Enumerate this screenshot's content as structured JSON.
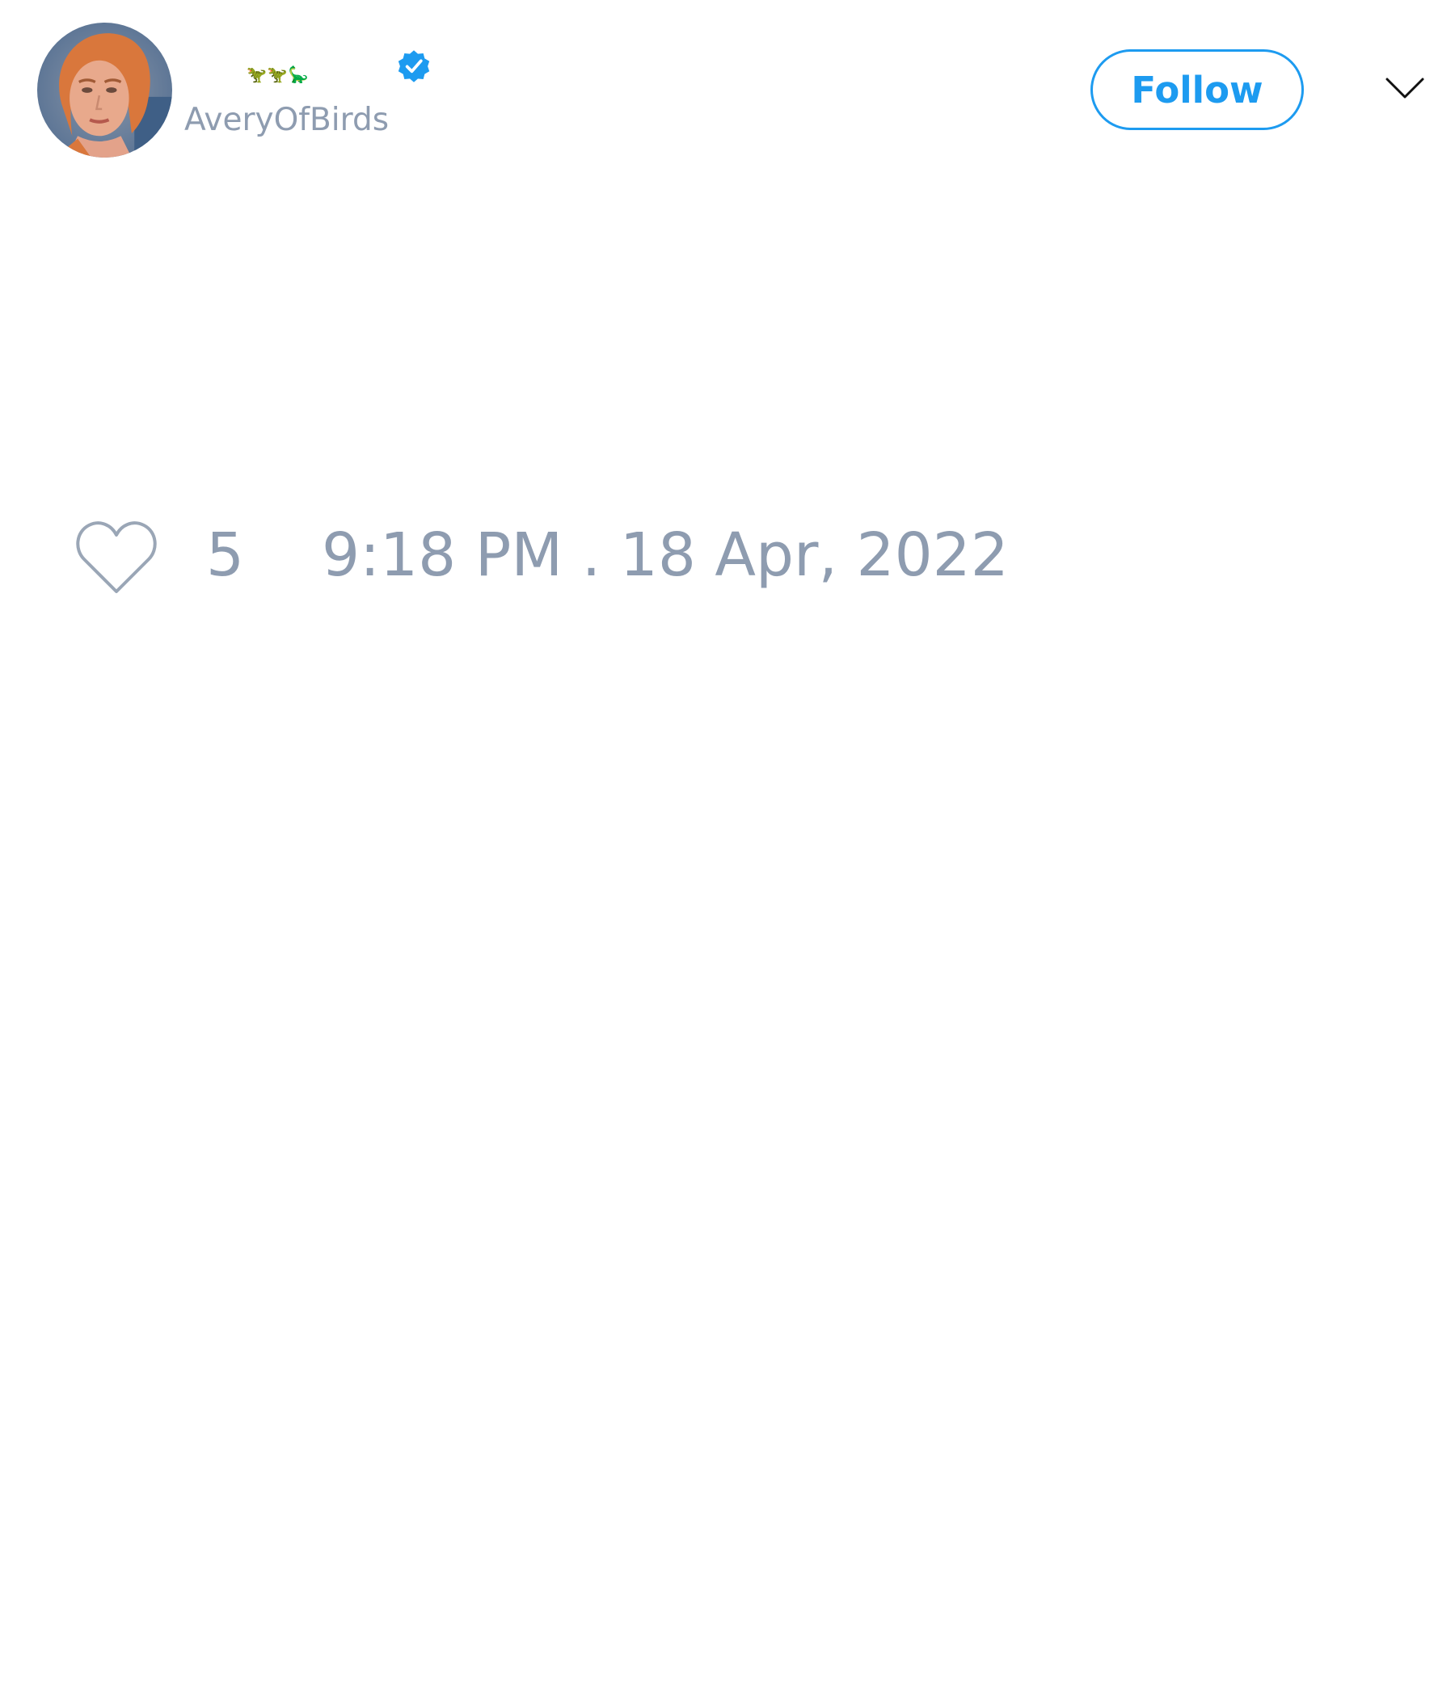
{
  "author": {
    "display_name_emoji": "🦖🦖🦕",
    "handle": "AveryOfBirds",
    "verified": true,
    "avatar_icon": "profile-photo"
  },
  "actions": {
    "follow_label": "Follow",
    "menu_icon": "chevron-down-icon"
  },
  "footer": {
    "like_icon": "heart-outline-icon",
    "like_count": "5",
    "timestamp": "9:18 PM . 18 Apr, 2022"
  },
  "colors": {
    "accent": "#1d9bf0",
    "muted_text": "#8e9cb0",
    "background": "#ffffff"
  }
}
